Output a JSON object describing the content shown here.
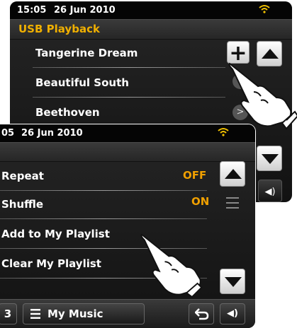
{
  "back_screen": {
    "status": {
      "time": "15:05",
      "date": "26 Jun 2010"
    },
    "title": "USB Playback",
    "items": [
      {
        "label": "Tangerine Dream"
      },
      {
        "label": "Beautiful South"
      },
      {
        "label": "Beethoven"
      }
    ],
    "add_button_label": "+",
    "next_arrow": ">"
  },
  "front_screen": {
    "status": {
      "time": "05",
      "date": "26 Jun 2010"
    },
    "items": [
      {
        "label": "Repeat",
        "value": "OFF"
      },
      {
        "label": "Shuffle",
        "value": "ON"
      },
      {
        "label": "Add to My Playlist"
      },
      {
        "label": "Clear My Playlist"
      }
    ],
    "bottom_bar": {
      "left_icon_label": "3",
      "menu_label": "My Music"
    }
  },
  "colors": {
    "accent": "#f0b000",
    "status_bg": "#050505",
    "screen_bg": "#1e1e1e"
  },
  "icons": [
    "wifi-icon",
    "up-arrow-icon",
    "down-arrow-icon",
    "add-icon",
    "speaker-icon",
    "back-icon",
    "menu-icon",
    "pointing-hand-icon"
  ]
}
